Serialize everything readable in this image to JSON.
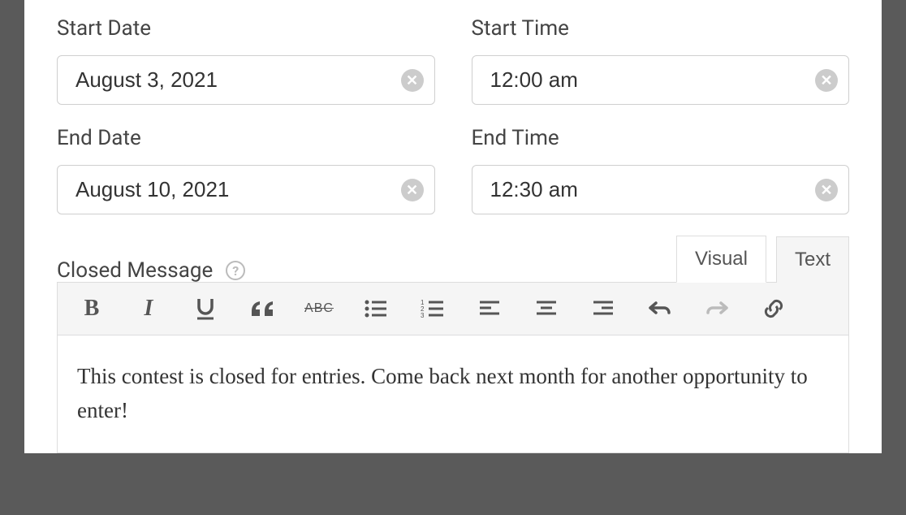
{
  "fields": {
    "start_date": {
      "label": "Start Date",
      "value": "August 3, 2021"
    },
    "start_time": {
      "label": "Start Time",
      "value": "12:00 am"
    },
    "end_date": {
      "label": "End Date",
      "value": "August 10, 2021"
    },
    "end_time": {
      "label": "End Time",
      "value": "12:30 am"
    }
  },
  "closed_message": {
    "label": "Closed Message",
    "tabs": {
      "visual": "Visual",
      "text": "Text",
      "active": "visual"
    },
    "toolbar": {
      "bold": "B",
      "italic": "I",
      "strike": "ABC"
    },
    "content": "This contest is closed for entries. Come back next month for another opportunity to enter!"
  }
}
